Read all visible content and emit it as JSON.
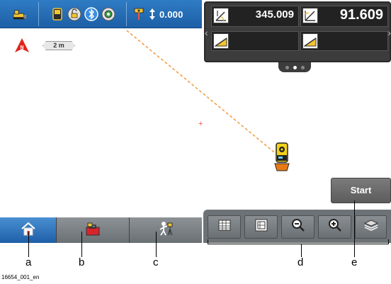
{
  "status_bar": {
    "height_value": "0.000",
    "icons": [
      "machine-icon",
      "controller-icon",
      "lock-icon",
      "bluetooth-icon",
      "gps-target-icon",
      "pole-height-icon",
      "up-down-arrow-icon"
    ]
  },
  "value_panel": {
    "cell1_value": "345.009",
    "cell2_value": "91.609",
    "cell1_icon": "horizontal-angle-icon",
    "cell2_icon": "vertical-angle-icon",
    "cell3_icon": "slope-distance-icon",
    "cell4_icon": "slope-distance-2-icon",
    "page_dots": 3,
    "active_dot": 2
  },
  "map": {
    "north_label": "N",
    "scale_label": "2 m",
    "crosshair": "+",
    "line_color": "#f09a3e"
  },
  "start_button": {
    "label": "Start"
  },
  "bottom_tabs": [
    {
      "name": "home",
      "icon": "home-icon"
    },
    {
      "name": "machine-tools",
      "icon": "toolbox-icon"
    },
    {
      "name": "survey",
      "icon": "surveyor-icon"
    }
  ],
  "toolbar": [
    {
      "name": "table",
      "icon": "table-icon"
    },
    {
      "name": "view",
      "icon": "layout-icon"
    },
    {
      "name": "zoom-out",
      "icon": "zoom-out-icon"
    },
    {
      "name": "zoom-in",
      "icon": "zoom-in-icon"
    },
    {
      "name": "layers",
      "icon": "layers-icon"
    }
  ],
  "callouts": {
    "a": "a",
    "b": "b",
    "c": "c",
    "d": "d",
    "e": "e"
  },
  "figure_id": "16654_001_en",
  "colors": {
    "accent_blue": "#1c5fa6",
    "toolbar_gray": "#6d7276",
    "trace_orange": "#f09a3e",
    "total_station_yellow": "#f2d21b"
  }
}
